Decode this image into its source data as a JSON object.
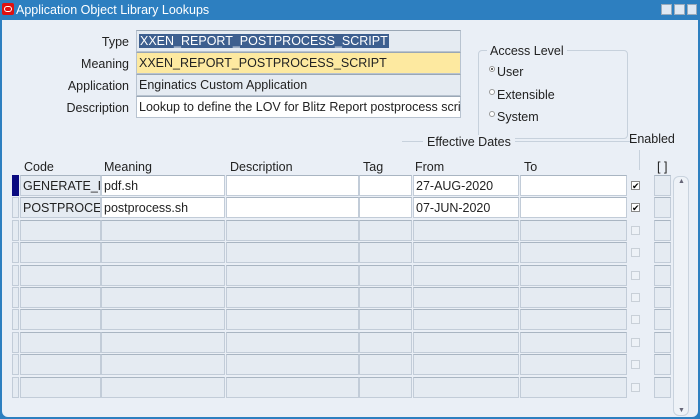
{
  "window": {
    "title": "Application Object Library Lookups"
  },
  "header": {
    "type_label": "Type",
    "type_value": "XXEN_REPORT_POSTPROCESS_SCRIPT",
    "meaning_label": "Meaning",
    "meaning_value": "XXEN_REPORT_POSTPROCESS_SCRIPT",
    "application_label": "Application",
    "application_value": "Enginatics Custom Application",
    "description_label": "Description",
    "description_value": "Lookup to define the LOV for Blitz Report postprocess scrip"
  },
  "access_level": {
    "title": "Access Level",
    "options": [
      "User",
      "Extensible",
      "System"
    ],
    "selected": "User"
  },
  "table": {
    "group_label": "Effective Dates",
    "enabled_label": "Enabled",
    "flex_label": "[ ]",
    "columns": [
      "Code",
      "Meaning",
      "Description",
      "Tag",
      "From",
      "To"
    ],
    "rows": [
      {
        "code": "GENERATE_PDF",
        "meaning": "pdf.sh",
        "description": "",
        "tag": "",
        "from": "27-AUG-2020",
        "to": "",
        "enabled": true
      },
      {
        "code": "POSTPROCESS",
        "meaning": "postprocess.sh",
        "description": "",
        "tag": "",
        "from": "07-JUN-2020",
        "to": "",
        "enabled": true
      }
    ],
    "total_rows": 10
  }
}
